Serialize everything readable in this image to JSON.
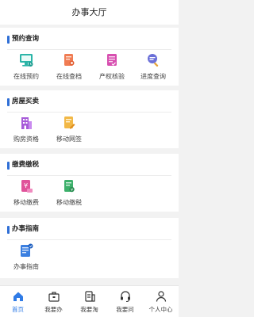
{
  "header": {
    "title": "办事大厅"
  },
  "sections": [
    {
      "title": "预约查询",
      "items": [
        {
          "label": "在线预约",
          "icon": "monitor-calendar-icon"
        },
        {
          "label": "在线查档",
          "icon": "document-search-icon"
        },
        {
          "label": "产权核验",
          "icon": "certificate-check-icon"
        },
        {
          "label": "进度查询",
          "icon": "progress-search-icon"
        }
      ]
    },
    {
      "title": "房屋买卖",
      "items": [
        {
          "label": "购房资格",
          "icon": "building-icon"
        },
        {
          "label": "移动网签",
          "icon": "contract-sign-icon"
        }
      ]
    },
    {
      "title": "缴费缴税",
      "items": [
        {
          "label": "移动缴费",
          "icon": "payment-card-icon"
        },
        {
          "label": "移动缴税",
          "icon": "tax-form-icon"
        }
      ]
    },
    {
      "title": "办事指南",
      "items": [
        {
          "label": "办事指南",
          "icon": "guide-book-icon"
        }
      ]
    }
  ],
  "tabbar": [
    {
      "label": "首页",
      "icon": "home-icon",
      "active": true
    },
    {
      "label": "我要办",
      "icon": "briefcase-icon",
      "active": false
    },
    {
      "label": "我要淘",
      "icon": "file-list-icon",
      "active": false
    },
    {
      "label": "我要问",
      "icon": "headset-icon",
      "active": false
    },
    {
      "label": "个人中心",
      "icon": "person-icon",
      "active": false
    }
  ],
  "colors": {
    "accent": "#2f6fd6",
    "active_tab": "#2f7be6",
    "page_bg": "#f2f2f2"
  }
}
